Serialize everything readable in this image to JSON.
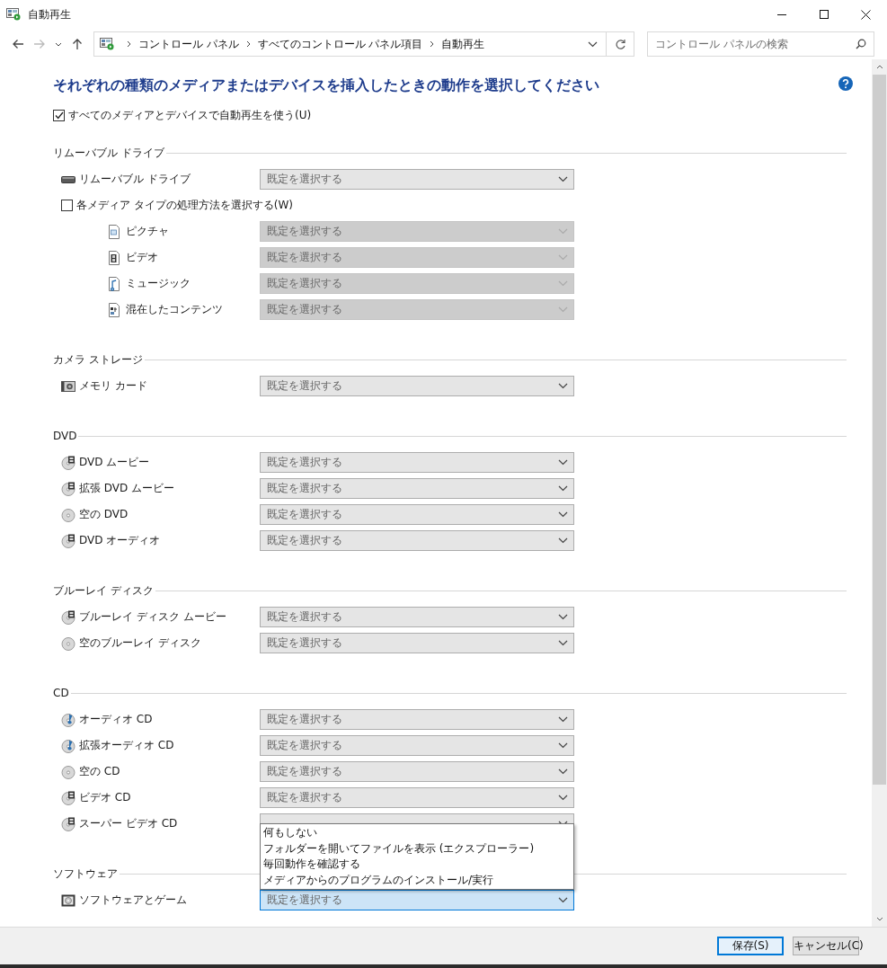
{
  "window": {
    "title": "自動再生"
  },
  "address_bar": {
    "breadcrumb": [
      "コントロール パネル",
      "すべてのコントロール パネル項目",
      "自動再生"
    ]
  },
  "search": {
    "placeholder": "コントロール パネルの検索"
  },
  "heading": "それぞれの種類のメディアまたはデバイスを挿入したときの動作を選択してください",
  "autoplay_all": {
    "label": "すべてのメディアとデバイスで自動再生を使う(U)",
    "checked": true
  },
  "sections": [
    {
      "title": "リムーバブル ドライブ",
      "items": [
        {
          "kind": "drive",
          "label": "リムーバブル ドライブ",
          "value": "既定を選択する",
          "disabled": false,
          "focused": false,
          "expanded": false
        },
        {
          "kind": "checkbox",
          "label": "各メディア タイプの処理方法を選択する(W)",
          "checked": false,
          "children": [
            {
              "kind": "picture",
              "label": "ピクチャ",
              "value": "既定を選択する",
              "disabled": true,
              "focused": false,
              "expanded": false
            },
            {
              "kind": "video",
              "label": "ビデオ",
              "value": "既定を選択する",
              "disabled": true,
              "focused": false,
              "expanded": false
            },
            {
              "kind": "music",
              "label": "ミュージック",
              "value": "既定を選択する",
              "disabled": true,
              "focused": false,
              "expanded": false
            },
            {
              "kind": "mixed",
              "label": "混在したコンテンツ",
              "value": "既定を選択する",
              "disabled": true,
              "focused": false,
              "expanded": false
            }
          ]
        }
      ]
    },
    {
      "title": "カメラ ストレージ",
      "items": [
        {
          "kind": "memory-card",
          "label": "メモリ カード",
          "value": "既定を選択する",
          "disabled": false,
          "focused": false,
          "expanded": false
        }
      ]
    },
    {
      "title": "DVD",
      "items": [
        {
          "kind": "film-disc",
          "label": "DVD ムービー",
          "value": "既定を選択する",
          "disabled": false,
          "focused": false,
          "expanded": false
        },
        {
          "kind": "film-disc",
          "label": "拡張 DVD ムービー",
          "value": "既定を選択する",
          "disabled": false,
          "focused": false,
          "expanded": false
        },
        {
          "kind": "blank-disc",
          "label": "空の DVD",
          "value": "既定を選択する",
          "disabled": false,
          "focused": false,
          "expanded": false
        },
        {
          "kind": "film-disc",
          "label": "DVD オーディオ",
          "value": "既定を選択する",
          "disabled": false,
          "focused": false,
          "expanded": false
        }
      ]
    },
    {
      "title": "ブルーレイ ディスク",
      "items": [
        {
          "kind": "film-disc",
          "label": "ブルーレイ ディスク ムービー",
          "value": "既定を選択する",
          "disabled": false,
          "focused": false,
          "expanded": false
        },
        {
          "kind": "blank-disc",
          "label": "空のブルーレイ ディスク",
          "value": "既定を選択する",
          "disabled": false,
          "focused": false,
          "expanded": false
        }
      ]
    },
    {
      "title": "CD",
      "items": [
        {
          "kind": "music-disc",
          "label": "オーディオ CD",
          "value": "既定を選択する",
          "disabled": false,
          "focused": false,
          "expanded": false
        },
        {
          "kind": "music-disc",
          "label": "拡張オーディオ CD",
          "value": "既定を選択する",
          "disabled": false,
          "focused": false,
          "expanded": false
        },
        {
          "kind": "blank-disc",
          "label": "空の CD",
          "value": "既定を選択する",
          "disabled": false,
          "focused": false,
          "expanded": false
        },
        {
          "kind": "film-disc",
          "label": "ビデオ CD",
          "value": "既定を選択する",
          "disabled": false,
          "focused": false,
          "expanded": false
        },
        {
          "kind": "film-disc",
          "label": "スーパー ビデオ CD",
          "disabled": false,
          "focused": false,
          "expanded": false
        }
      ]
    },
    {
      "title": "ソフトウェア",
      "items": [
        {
          "kind": "software",
          "label": "ソフトウェアとゲーム",
          "value": "既定を選択する",
          "disabled": false,
          "focused": true,
          "expanded": true,
          "options": [
            "何もしない",
            "フォルダーを開いてファイルを表示 (エクスプローラー)",
            "毎回動作を確認する",
            "メディアからのプログラムのインストール/実行"
          ]
        }
      ]
    }
  ],
  "buttons": [
    {
      "label": "保存(S)",
      "default": true
    },
    {
      "label": "キャンセル(C)",
      "default": false
    }
  ]
}
